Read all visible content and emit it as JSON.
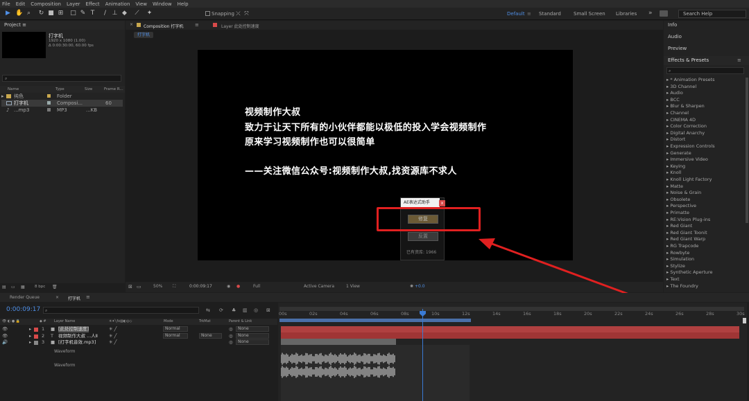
{
  "menu": [
    "File",
    "Edit",
    "Composition",
    "Layer",
    "Effect",
    "Animation",
    "View",
    "Window",
    "Help"
  ],
  "toolbar": {
    "snapping_label": "Snapping",
    "workspaces": [
      "Default",
      "Standard",
      "Small Screen",
      "Libraries"
    ],
    "search_placeholder": "Search Help"
  },
  "project": {
    "tab_label": "Project",
    "comp_name": "打字机",
    "comp_res": "1920 x 1080 (1.00)",
    "comp_dur": "Δ 0:00:30:00, 60.00 fps",
    "columns": [
      "Name",
      "Type",
      "Size",
      "Frame R..."
    ],
    "items": [
      {
        "name": "纯色",
        "type": "Folder",
        "size": ""
      },
      {
        "name": "打字机",
        "type": "Composi...",
        "size": "60"
      },
      {
        "name": "...mp3",
        "type": "MP3",
        "size": "...KB"
      }
    ],
    "bpc": "8 bpc"
  },
  "comp_panel": {
    "tab_label": "Composition 打字机",
    "layer_tab": "Layer 此处控制速度",
    "breadcrumb": "打字机",
    "lines": [
      "视频制作大叔",
      "致力于让天下所有的小伙伴都能以极低的投入学会视频制作",
      "原来学习视频制作也可以很简单",
      "——关注微信公众号:视频制作大叔,找资源库不求人"
    ],
    "zoom": "50%",
    "timecode": "0:00:09:17",
    "resolution": "Full",
    "camera": "Active Camera",
    "view": "1 View",
    "offset": "+0.0"
  },
  "dialog": {
    "title": "AE表达式助手",
    "close": "x",
    "btn1": "修复",
    "btn2": "反置",
    "footer": "已有资库: 1966"
  },
  "right_panel": {
    "info": "Info",
    "audio": "Audio",
    "preview": "Preview",
    "effects_title": "Effects & Presets",
    "effects": [
      "* Animation Presets",
      "3D Channel",
      "Audio",
      "BCC",
      "Blur & Sharpen",
      "Channel",
      "CINEMA 4D",
      "Color Correction",
      "Digital Anarchy",
      "Distort",
      "Expression Controls",
      "Generate",
      "Immersive Video",
      "Keying",
      "Knoll",
      "Knoll Light Factory",
      "Matte",
      "Noise & Grain",
      "Obsolete",
      "Perspective",
      "Primatte",
      "RE:Vision Plug-ins",
      "Red Giant",
      "Red Giant Toonit",
      "Red Giant Warp",
      "RG Trapcode",
      "Rowbyte",
      "Simulation",
      "Stylize",
      "Synthetic Aperture",
      "Text",
      "The Foundry"
    ]
  },
  "timeline": {
    "render_queue": "Render Queue",
    "comp_tab": "打字机",
    "timecode": "0:00:09:17",
    "cols": {
      "name": "Layer Name",
      "mode": "Mode",
      "trkmat": "TrkMat",
      "parent": "Parent & Link"
    },
    "layers": [
      {
        "num": "1",
        "name": "[此处控制速度]",
        "mode": "Normal",
        "trkmat": "",
        "parent": "None"
      },
      {
        "num": "2",
        "name": "视频制作大叔 ...人Ⅱ",
        "mode": "Normal",
        "trkmat": "None",
        "parent": "None"
      },
      {
        "num": "3",
        "name": "[打字机音效.mp3]",
        "mode": "",
        "trkmat": "",
        "parent": "None"
      }
    ],
    "waveform_labels": [
      "Waveform",
      "Waveform"
    ],
    "ruler": [
      "00s",
      "02s",
      "04s",
      "06s",
      "08s",
      "10s",
      "12s",
      "14s",
      "16s",
      "18s",
      "20s",
      "22s",
      "24s",
      "26s",
      "28s",
      "30s"
    ]
  },
  "colors": {
    "accent": "#4f8fe6",
    "red": "#e02020",
    "playhead": "#3a7bd5",
    "layer_bar": "#b04040"
  }
}
